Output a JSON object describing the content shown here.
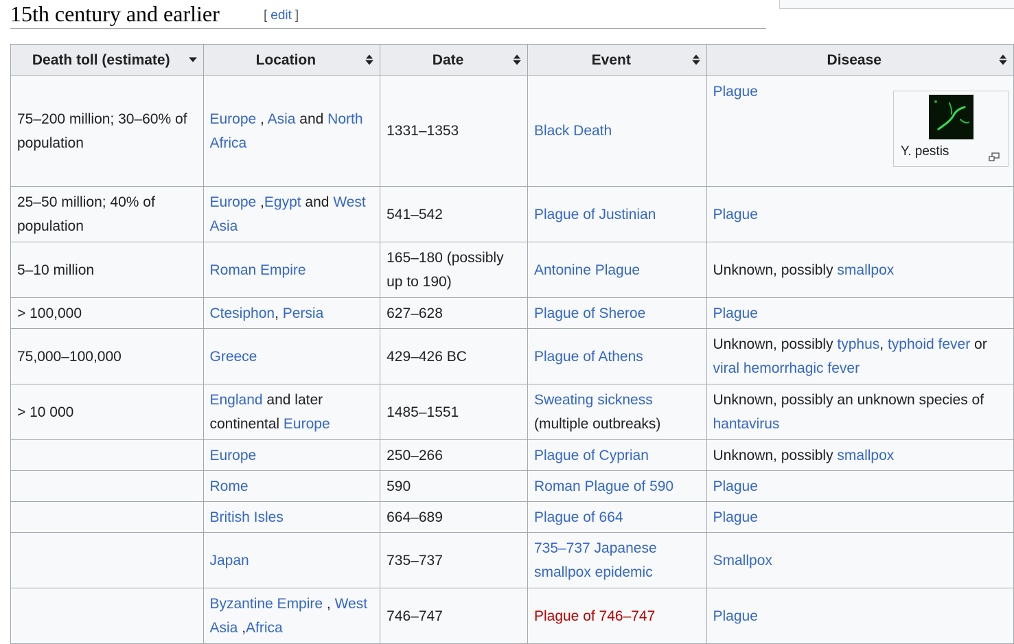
{
  "section": {
    "title": "15th century and earlier",
    "edit_open": "[",
    "edit_label": "edit",
    "edit_close": "]"
  },
  "table": {
    "headers": [
      {
        "label": "Death toll (estimate)",
        "sort": "sorted-descending-icon"
      },
      {
        "label": "Location",
        "sort": "sort-both-icon"
      },
      {
        "label": "Date",
        "sort": "sort-both-icon"
      },
      {
        "label": "Event",
        "sort": "sort-both-icon"
      },
      {
        "label": "Disease",
        "sort": "sort-both-icon"
      }
    ],
    "rows": [
      {
        "toll": "75–200 million; 30–60% of population",
        "location": [
          {
            "t": "Europe",
            "l": true
          },
          {
            "t": " , ",
            "l": false
          },
          {
            "t": "Asia",
            "l": true
          },
          {
            "t": " and ",
            "l": false
          },
          {
            "t": "North Africa",
            "l": true
          }
        ],
        "date": "1331–1353",
        "event": [
          {
            "t": "Black Death",
            "l": true
          }
        ],
        "disease": [
          {
            "t": "Plague",
            "l": true
          }
        ],
        "thumb_caption": "Y. pestis"
      },
      {
        "toll": "25–50 million; 40% of population",
        "location": [
          {
            "t": "Europe",
            "l": true
          },
          {
            "t": " ,",
            "l": false
          },
          {
            "t": "Egypt",
            "l": true
          },
          {
            "t": " and ",
            "l": false
          },
          {
            "t": "West Asia",
            "l": true
          }
        ],
        "date": "541–542",
        "event": [
          {
            "t": "Plague of Justinian",
            "l": true
          }
        ],
        "disease": [
          {
            "t": "Plague",
            "l": true
          }
        ]
      },
      {
        "toll": "5–10 million",
        "location": [
          {
            "t": "Roman Empire",
            "l": true
          }
        ],
        "date": "165–180 (possibly up to 190)",
        "event": [
          {
            "t": "Antonine Plague",
            "l": true
          }
        ],
        "disease": [
          {
            "t": "Unknown, possibly ",
            "l": false
          },
          {
            "t": "smallpox",
            "l": true
          }
        ]
      },
      {
        "toll": "> 100,000",
        "location": [
          {
            "t": "Ctesiphon",
            "l": true
          },
          {
            "t": ", ",
            "l": false
          },
          {
            "t": "Persia",
            "l": true
          }
        ],
        "date": "627–628",
        "event": [
          {
            "t": "Plague of Sheroe",
            "l": true
          }
        ],
        "disease": [
          {
            "t": "Plague",
            "l": true
          }
        ]
      },
      {
        "toll": "75,000–100,000",
        "location": [
          {
            "t": "Greece",
            "l": true
          }
        ],
        "date": "429–426 BC",
        "event": [
          {
            "t": "Plague of Athens",
            "l": true
          }
        ],
        "disease": [
          {
            "t": "Unknown, possibly ",
            "l": false
          },
          {
            "t": "typhus",
            "l": true
          },
          {
            "t": ", ",
            "l": false
          },
          {
            "t": "typhoid fever",
            "l": true
          },
          {
            "t": " or ",
            "l": false
          },
          {
            "t": "viral hemorrhagic fever",
            "l": true
          }
        ]
      },
      {
        "toll": "> 10 000",
        "location": [
          {
            "t": "England",
            "l": true
          },
          {
            "t": " and later continental ",
            "l": false
          },
          {
            "t": "Europe",
            "l": true
          }
        ],
        "date": "1485–1551",
        "event": [
          {
            "t": "Sweating sickness",
            "l": true
          },
          {
            "t": " (multiple outbreaks)",
            "l": false
          }
        ],
        "disease": [
          {
            "t": "Unknown, possibly an unknown species of ",
            "l": false
          },
          {
            "t": "hantavirus",
            "l": true
          }
        ]
      },
      {
        "toll": "",
        "location": [
          {
            "t": "Europe",
            "l": true
          }
        ],
        "date": "250–266",
        "event": [
          {
            "t": "Plague of Cyprian",
            "l": true
          }
        ],
        "disease": [
          {
            "t": "Unknown, possibly ",
            "l": false
          },
          {
            "t": "smallpox",
            "l": true
          }
        ]
      },
      {
        "toll": "",
        "location": [
          {
            "t": "Rome",
            "l": true
          }
        ],
        "date": "590",
        "event": [
          {
            "t": "Roman Plague of 590",
            "l": true
          }
        ],
        "disease": [
          {
            "t": "Plague",
            "l": true
          }
        ]
      },
      {
        "toll": "",
        "location": [
          {
            "t": "British Isles",
            "l": true
          }
        ],
        "date": "664–689",
        "event": [
          {
            "t": "Plague of 664",
            "l": true
          }
        ],
        "disease": [
          {
            "t": "Plague",
            "l": true
          }
        ]
      },
      {
        "toll": "",
        "location": [
          {
            "t": "Japan",
            "l": true
          }
        ],
        "date": "735–737",
        "event": [
          {
            "t": "735–737 Japanese smallpox epidemic",
            "l": true
          }
        ],
        "disease": [
          {
            "t": "Smallpox",
            "l": true
          }
        ]
      },
      {
        "toll": "",
        "location": [
          {
            "t": "Byzantine Empire",
            "l": true
          },
          {
            "t": " , ",
            "l": false
          },
          {
            "t": "West Asia",
            "l": true
          },
          {
            "t": " ,",
            "l": false
          },
          {
            "t": "Africa",
            "l": true
          }
        ],
        "date": "746–747",
        "event": [
          {
            "t": "Plague of 746–747",
            "l": true,
            "red": true
          }
        ],
        "disease": [
          {
            "t": "Plague",
            "l": true
          }
        ]
      }
    ]
  },
  "colors": {
    "link": "#3366cc",
    "redlink": "#ba0000",
    "header_bg": "#eaecf0",
    "cell_bg": "#f8f9fa",
    "border": "#a2a9b1"
  },
  "icons": {
    "thumb_enlarge": "magnify-icon"
  }
}
